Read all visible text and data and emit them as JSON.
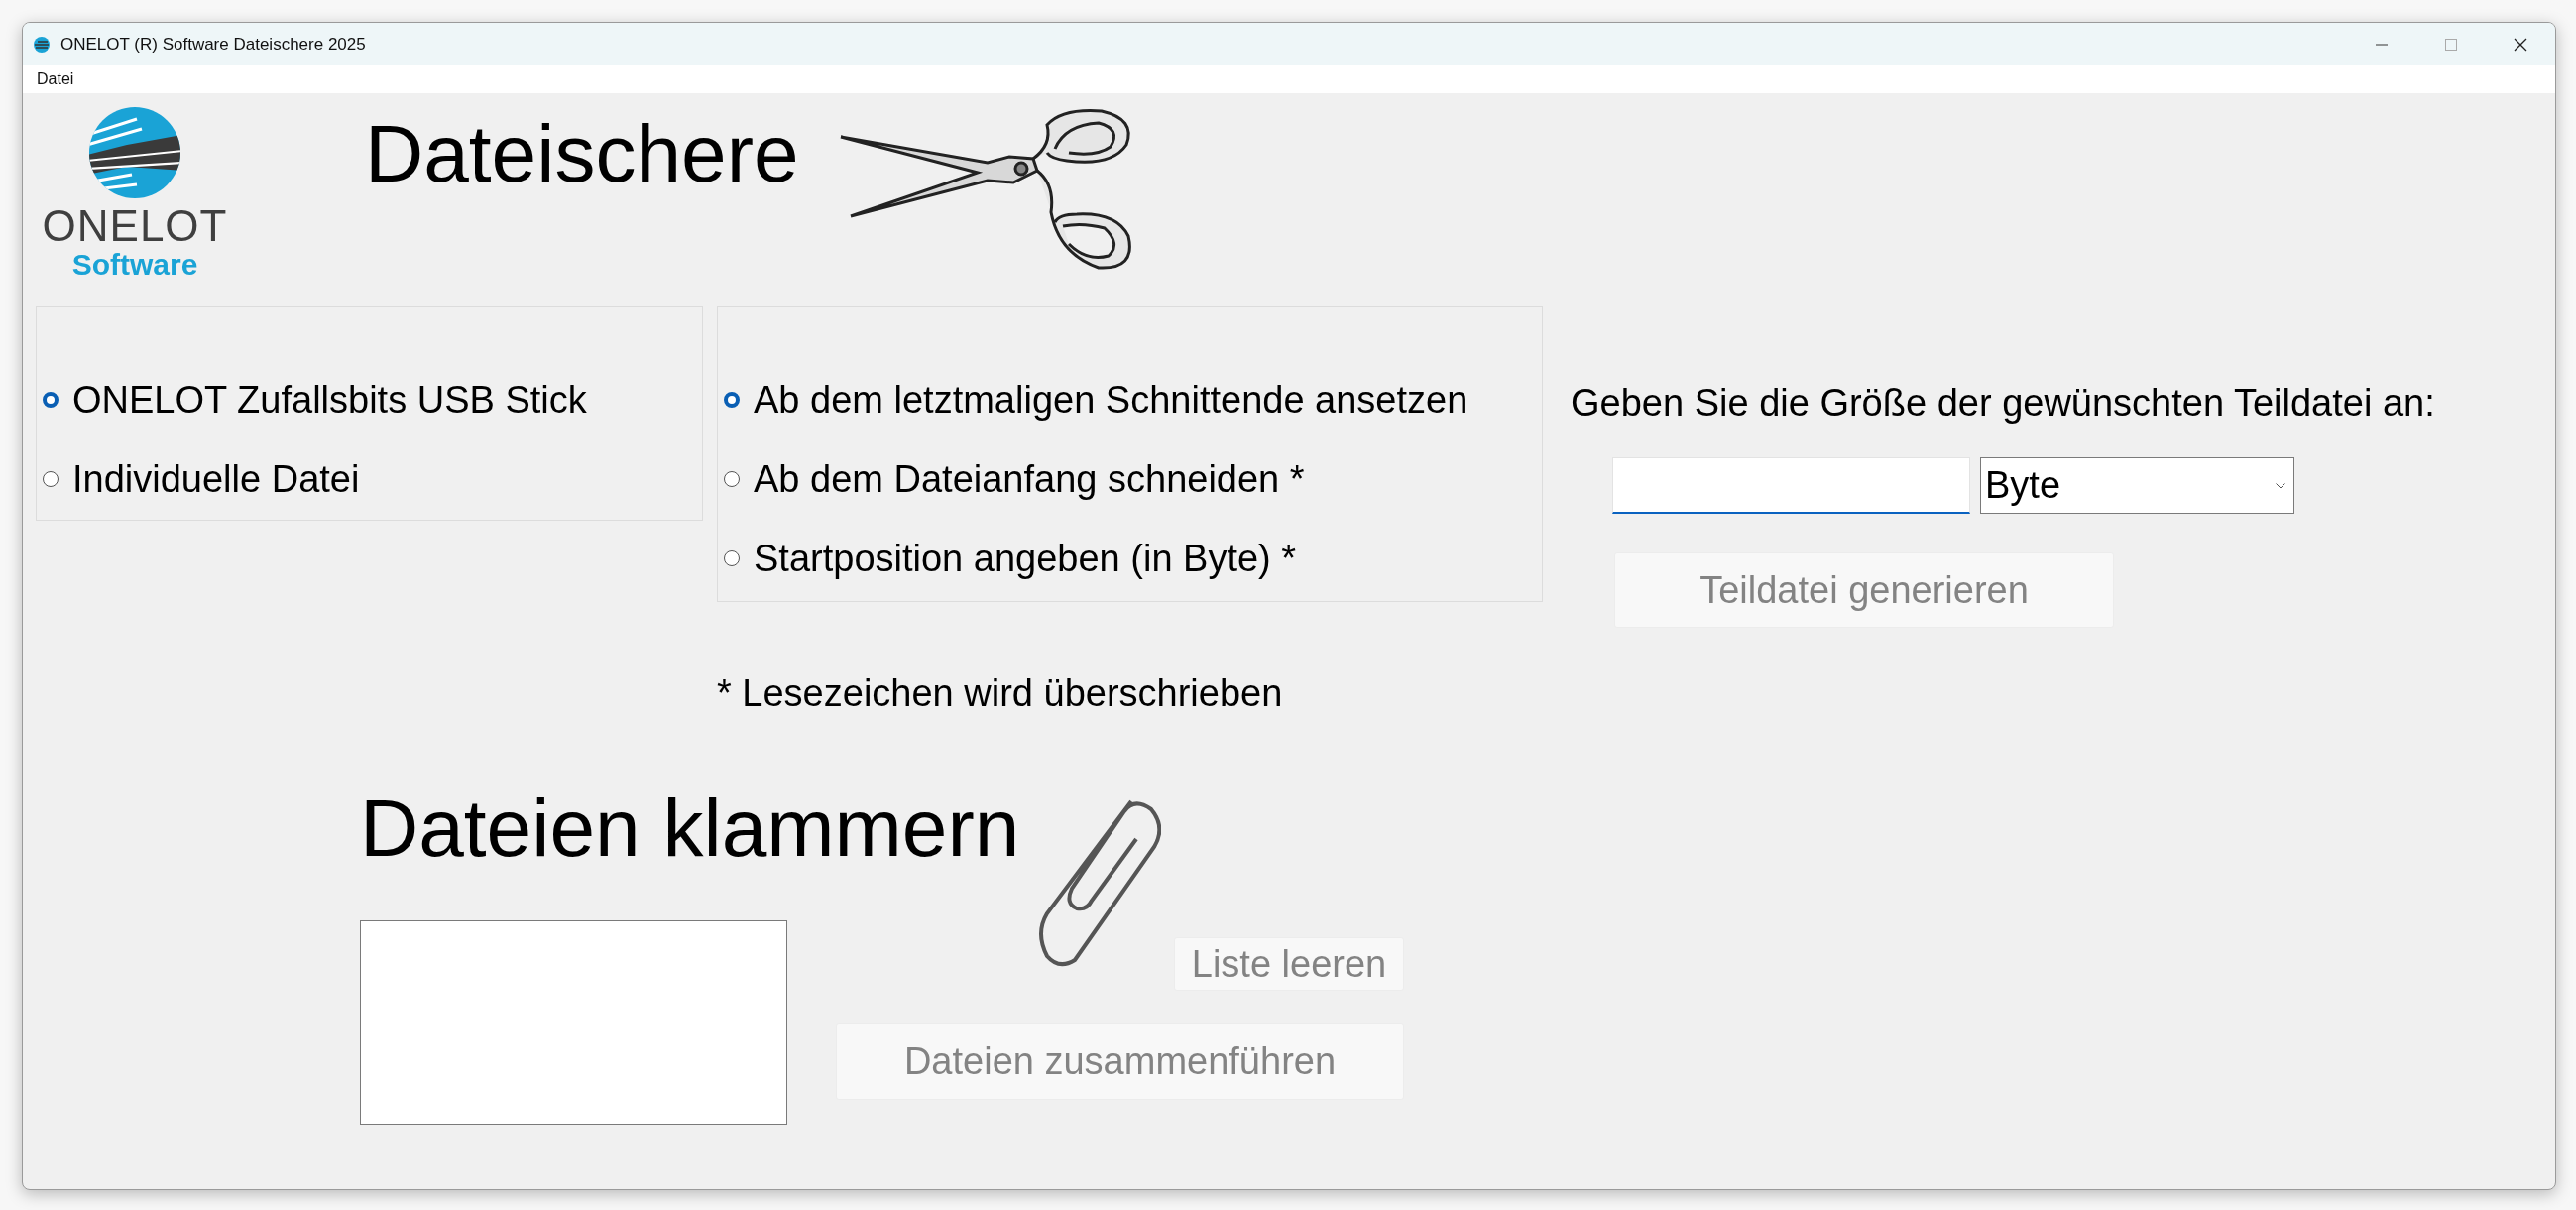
{
  "window": {
    "title": "ONELOT (R) Software Dateischere 2025"
  },
  "menu": [
    {
      "label": "Datei"
    }
  ],
  "logo": {
    "name": "ONELOT",
    "subtitle": "Software"
  },
  "cutter": {
    "heading": "Dateischere",
    "source_options": [
      {
        "label": "ONELOT Zufallsbits USB Stick",
        "selected": true
      },
      {
        "label": "Individuelle Datei",
        "selected": false
      }
    ],
    "start_options": [
      {
        "label": "Ab dem letztmaligen Schnittende ansetzen",
        "selected": true
      },
      {
        "label": "Ab dem Dateianfang schneiden *",
        "selected": false
      },
      {
        "label": "Startposition angeben (in Byte) *",
        "selected": false
      }
    ],
    "note": "* Lesezeichen wird überschrieben",
    "size_label": "Geben Sie die Größe der gewünschten Teildatei an:",
    "size_field": {
      "focused": true
    },
    "unit": "Byte",
    "generate_button": {
      "label": "Teildatei generieren",
      "disabled": true
    }
  },
  "merger": {
    "heading": "Dateien klammern",
    "clear_button": {
      "label": "Liste leeren",
      "disabled": true
    },
    "merge_button": {
      "label": "Dateien zusammenführen",
      "disabled": true
    }
  }
}
